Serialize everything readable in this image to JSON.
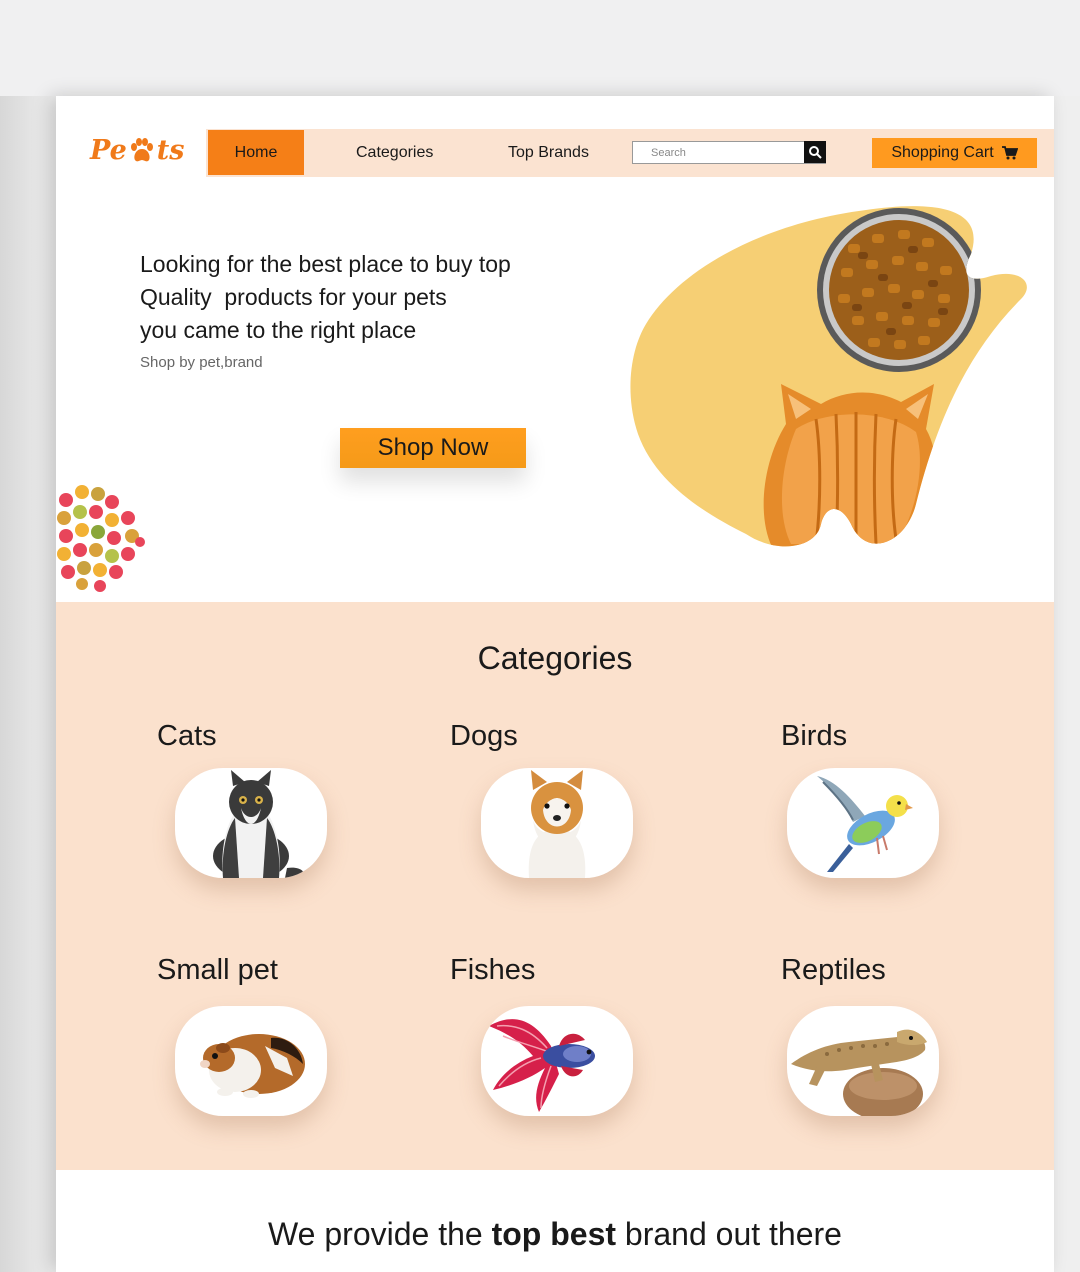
{
  "brand": {
    "logo_text_left": "Pe",
    "logo_text_right": "ts"
  },
  "nav": {
    "home": "Home",
    "categories": "Categories",
    "top_brands": "Top Brands",
    "search_placeholder": "Search",
    "cart": "Shopping Cart"
  },
  "hero": {
    "line1": "Looking for the best place to buy top",
    "line2": "Quality  products for your pets",
    "line3": "you came to the right place",
    "subtitle": "Shop by pet,brand",
    "cta": "Shop Now"
  },
  "categories": {
    "title": "Categories",
    "items": [
      {
        "label": "Cats",
        "icon": "cat-image"
      },
      {
        "label": "Dogs",
        "icon": "dog-image"
      },
      {
        "label": "Birds",
        "icon": "bird-image"
      },
      {
        "label": "Small pet",
        "icon": "guinea-pig-image"
      },
      {
        "label": "Fishes",
        "icon": "betta-fish-image"
      },
      {
        "label": "Reptiles",
        "icon": "lizard-image"
      }
    ]
  },
  "brands": {
    "title_pre": "We provide the ",
    "title_bold": "top best",
    "title_post": " brand out there"
  },
  "colors": {
    "accent": "#f57f17",
    "cart": "#ff9a1f",
    "nav_bg": "#fbe3d1",
    "section_bg": "#fbe1cd",
    "blob": "#f6cf74"
  }
}
